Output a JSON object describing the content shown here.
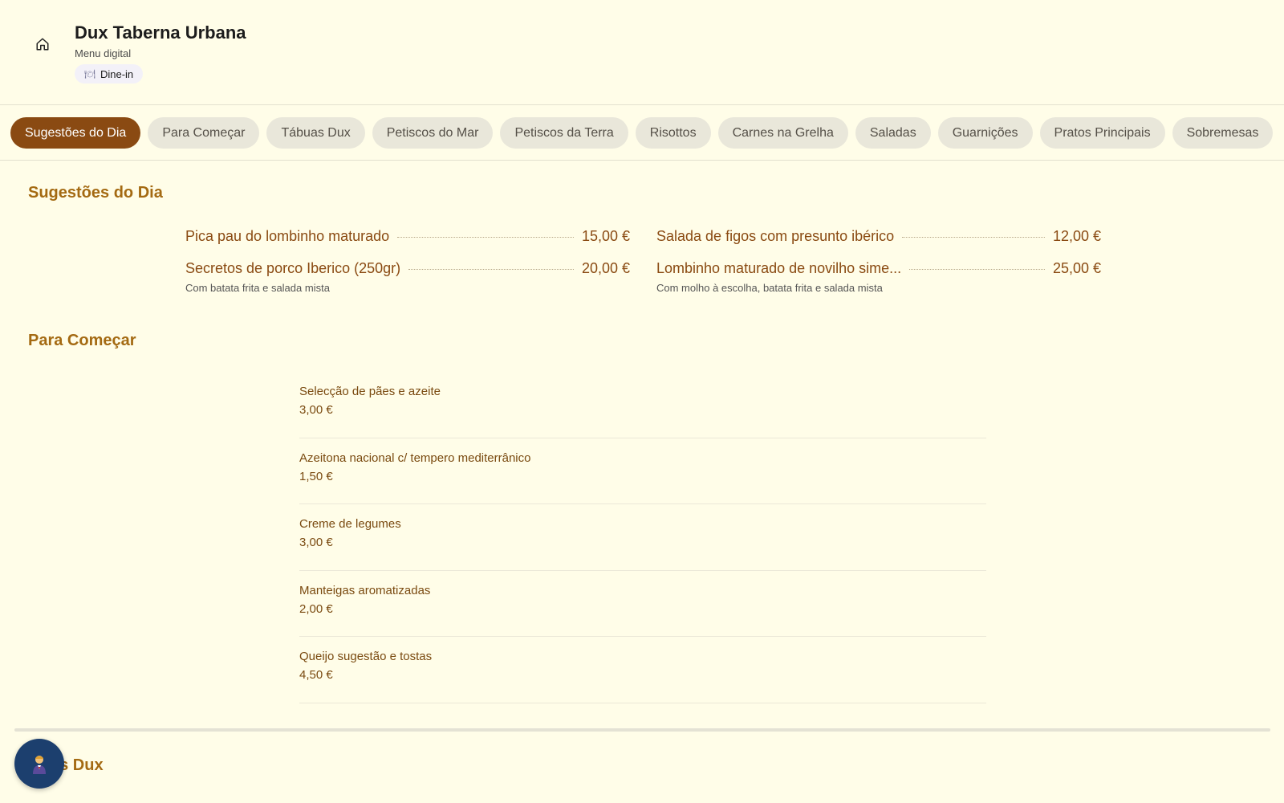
{
  "header": {
    "title": "Dux Taberna Urbana",
    "subtitle": "Menu digital",
    "mode_label": "Dine-in",
    "mode_icon": "plate-icon"
  },
  "tabs": [
    {
      "label": "Sugestões do Dia",
      "active": true
    },
    {
      "label": "Para Começar",
      "active": false
    },
    {
      "label": "Tábuas Dux",
      "active": false
    },
    {
      "label": "Petiscos do Mar",
      "active": false
    },
    {
      "label": "Petiscos da Terra",
      "active": false
    },
    {
      "label": "Risottos",
      "active": false
    },
    {
      "label": "Carnes na Grelha",
      "active": false
    },
    {
      "label": "Saladas",
      "active": false
    },
    {
      "label": "Guarnições",
      "active": false
    },
    {
      "label": "Pratos Principais",
      "active": false
    },
    {
      "label": "Sobremesas",
      "active": false
    }
  ],
  "sugestoes": {
    "title": "Sugestões do Dia",
    "items": [
      {
        "name": "Pica pau do lombinho maturado",
        "price": "15,00 €",
        "desc": ""
      },
      {
        "name": "Salada de figos com presunto ibérico",
        "price": "12,00 €",
        "desc": ""
      },
      {
        "name": "Secretos de porco Iberico (250gr)",
        "price": "20,00 €",
        "desc": "Com batata frita e salada mista"
      },
      {
        "name": "Lombinho maturado de novilho sime...",
        "price": "25,00 €",
        "desc": "Com molho à escolha, batata frita e salada mista"
      }
    ]
  },
  "para_comecar": {
    "title": "Para Começar",
    "items": [
      {
        "name": "Selecção de pães e azeite",
        "price": "3,00 €"
      },
      {
        "name": "Azeitona nacional c/ tempero mediterrânico",
        "price": "1,50 €"
      },
      {
        "name": "Creme de legumes",
        "price": "3,00 €"
      },
      {
        "name": "Manteigas aromatizadas",
        "price": "2,00 €"
      },
      {
        "name": "Queijo sugestão e tostas",
        "price": "4,50 €"
      }
    ]
  },
  "tabuas": {
    "title_visible": "as Dux"
  },
  "colors": {
    "background": "#fffde8",
    "accent": "#8a4a12",
    "section_title": "#a46a12",
    "assistant_bg": "#1c3f6e"
  }
}
